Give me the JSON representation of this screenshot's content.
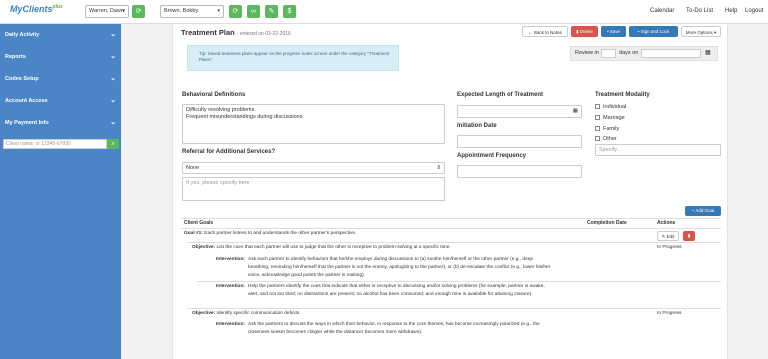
{
  "topbar": {
    "logo": "MyClients",
    "logo_sup": "plus",
    "clinician_select": "Warren, Dawn",
    "client_select": "Brown, Bobby",
    "nav": [
      "Calendar",
      "To-Do List",
      "Help",
      "Logout"
    ]
  },
  "sidebar": {
    "items": [
      "Daily Activity",
      "Reports",
      "Codes Setup",
      "Account Access",
      "My Payment Info"
    ],
    "search_placeholder": "Client name, or 12345-67890"
  },
  "main": {
    "title": "Treatment Plan",
    "subtitle": "- entered on 03-22-2016",
    "buttons": {
      "back": "Back to Notes",
      "delete": "Delete",
      "save": "Save",
      "sign_lock": "Sign and Lock",
      "more": "More Options"
    },
    "tip": "Tip: Saved treatment plans appear on the progress notes screen under the category \"Treatment Plans\".",
    "review": {
      "prefix": "Review in",
      "suffix": "days on"
    },
    "behavioral": {
      "label": "Behavioral Definitions",
      "value_line1": "Difficulty resolving problems.",
      "value_line2": "Frequent misunderstandings during discussions."
    },
    "referral": {
      "label": "Referral for Additional Services?",
      "value": "None",
      "placeholder": "If yes, please specify here"
    },
    "expected_length": {
      "label": "Expected Length of Treatment"
    },
    "initiation_date": {
      "label": "Initiation Date"
    },
    "appointment_frequency": {
      "label": "Appointment Frequency"
    },
    "modality": {
      "label": "Treatment Modality",
      "options": [
        "Individual",
        "Marriage",
        "Family",
        "Other"
      ],
      "specify_placeholder": "Specify..."
    },
    "add_goal": "+ Add Goal",
    "goals_table": {
      "headers": {
        "goals": "Client Goals",
        "completion": "Completion Date",
        "actions": "Actions"
      },
      "edit_label": "Edit",
      "goal1": {
        "prefix": "Goal #1:",
        "text": "Each partner listens to and understands the other partner's perspective.",
        "objective_label": "Objective:",
        "objective": "List the cues that each partner will use to judge that the other is receptive to problem-solving at a specific time.",
        "objective_status": "In Progress",
        "intervention_label": "Intervention:",
        "intervention1": "Ask each partner to identify behaviors that he/she employs during discussions to (a) soothe him/herself or the other partner (e.g., deep breathing, reminding him/herself that the partner is not the enemy, apologizing to the partner), or (b) de-escalate the conflict (e.g., lower his/her voice, acknowledge good points the partner is making).",
        "intervention2": "Help the partners identify the cues that indicate that either is receptive to discussing and/or solving problems (for example, partner is awake, alert, and not too tired; no distractions are present; no alcohol has been consumed; and enough time is available for attaining closure).",
        "objective2": "Identify specific communication deficits.",
        "objective2_status": "In Progress",
        "intervention3": "Ask the partners to discuss the ways in which their behavior, in response to the core themes, has become increasingly polarized (e.g., the closeness seeker becomes clingier while the distancer becomes more withdrawn)."
      }
    }
  }
}
